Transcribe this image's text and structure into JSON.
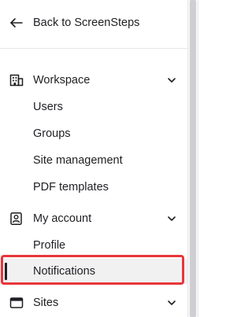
{
  "back": {
    "label": "Back to ScreenSteps",
    "icon": "arrow-left-icon"
  },
  "nav": {
    "workspace": {
      "label": "Workspace",
      "icon": "building-icon",
      "expanded": true,
      "items": [
        {
          "label": "Users"
        },
        {
          "label": "Groups"
        },
        {
          "label": "Site management"
        },
        {
          "label": "PDF templates"
        }
      ]
    },
    "account": {
      "label": "My account",
      "icon": "user-square-icon",
      "expanded": true,
      "items": [
        {
          "label": "Profile"
        },
        {
          "label": "Notifications",
          "active": true
        }
      ]
    },
    "sites": {
      "label": "Sites",
      "icon": "browser-window-icon",
      "expanded": false
    }
  },
  "colors": {
    "text": "#1f1f23",
    "active_bg": "#f1f1f2",
    "highlight": "#e8363b",
    "divider": "#e7e7ea"
  }
}
